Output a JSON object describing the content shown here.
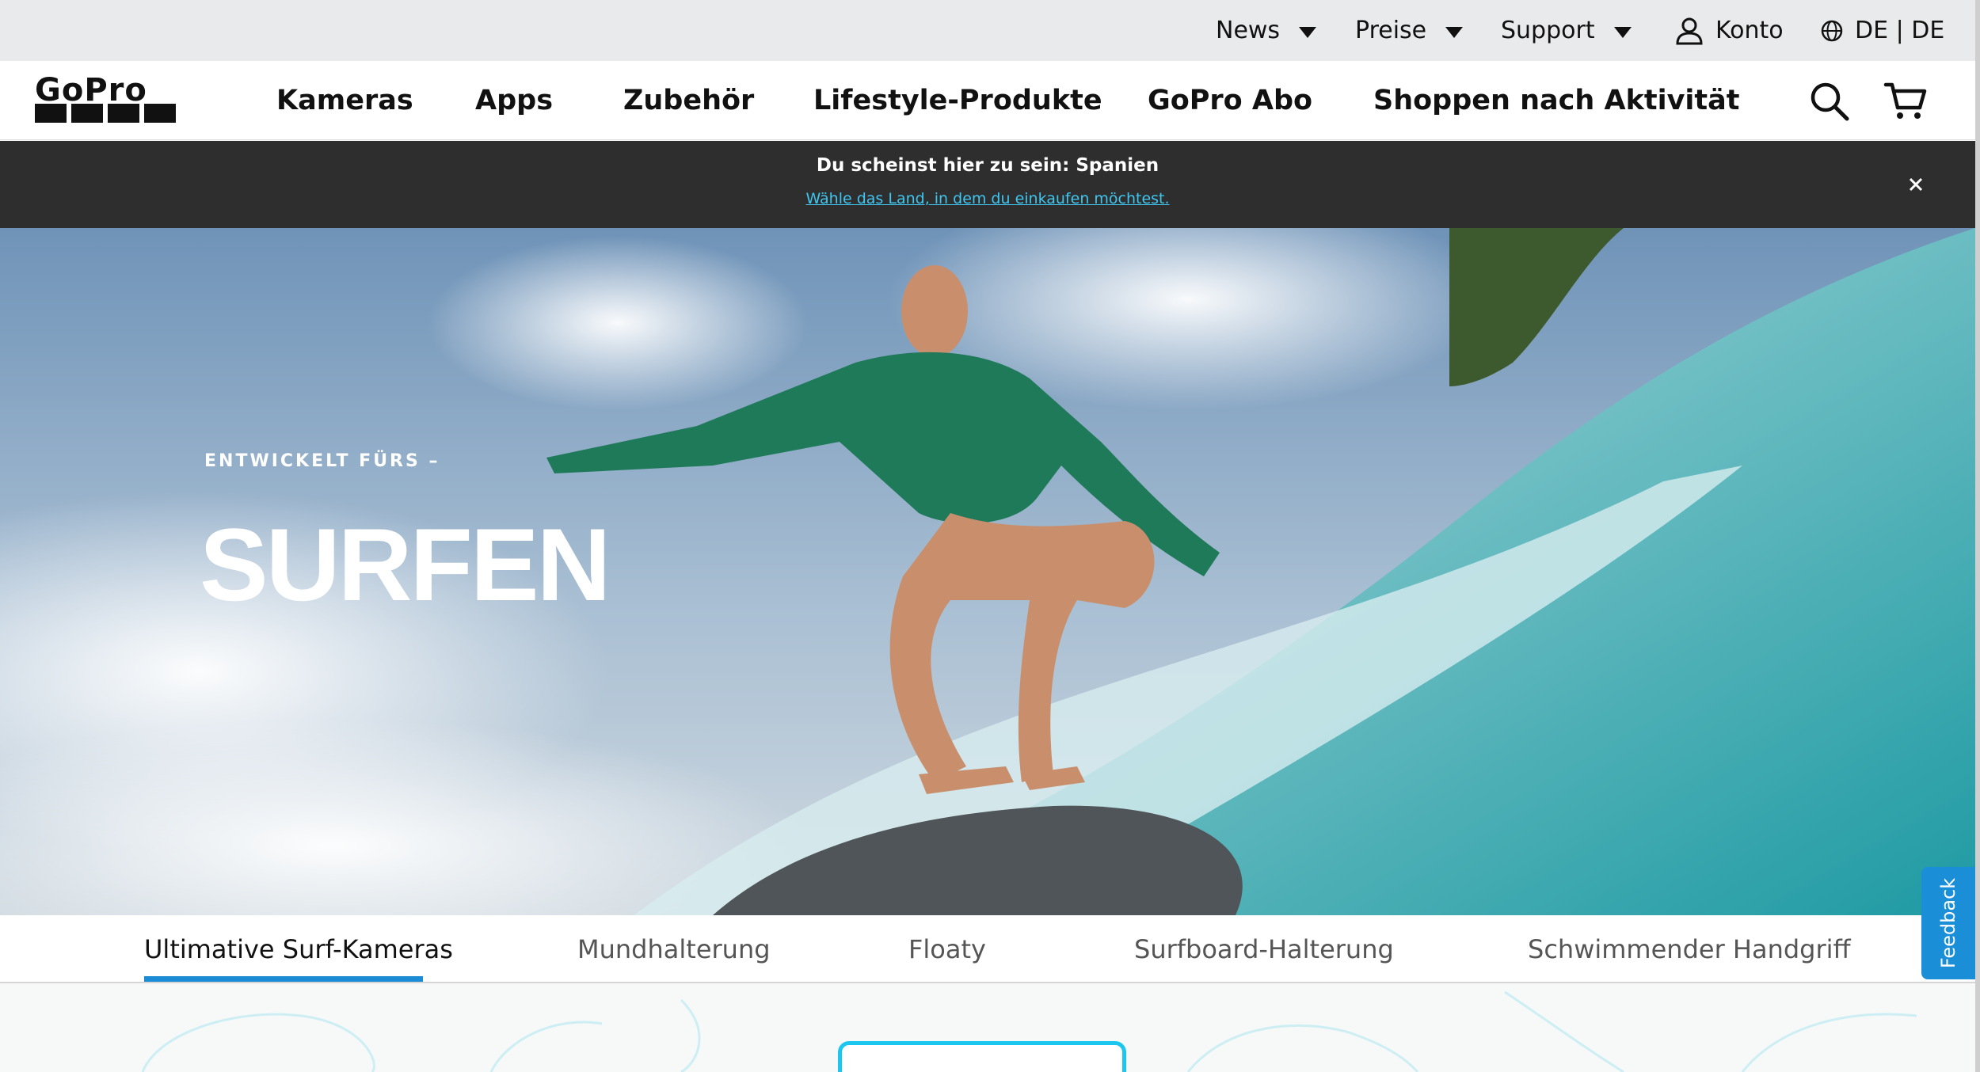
{
  "utility_bar": {
    "news": "News",
    "preise": "Preise",
    "support": "Support",
    "account": "Konto",
    "locale": "DE | DE"
  },
  "main_nav": {
    "logo": "GoPro",
    "items": [
      "Kameras",
      "Apps",
      "Zubehör",
      "Lifestyle-Produkte",
      "GoPro Abo",
      "Shoppen nach Aktivität"
    ]
  },
  "location_banner": {
    "title": "Du scheinst hier zu sein: Spanien",
    "link": "Wähle das Land, in dem du einkaufen möchtest."
  },
  "hero": {
    "eyebrow": "ENTWICKELT FÜRS –",
    "headline": "SURFEN"
  },
  "tabs": {
    "items": [
      "Ultimative Surf-Kameras",
      "Mundhalterung",
      "Floaty",
      "Surfboard-Halterung",
      "Schwimmender Handgriff"
    ],
    "active_index": 0
  },
  "feedback": "Feedback",
  "colors": {
    "accent": "#1c8bd6",
    "banner_bg": "#2e2e2e",
    "banner_link": "#3fc6f0",
    "card_outline": "#1cc7ef"
  }
}
